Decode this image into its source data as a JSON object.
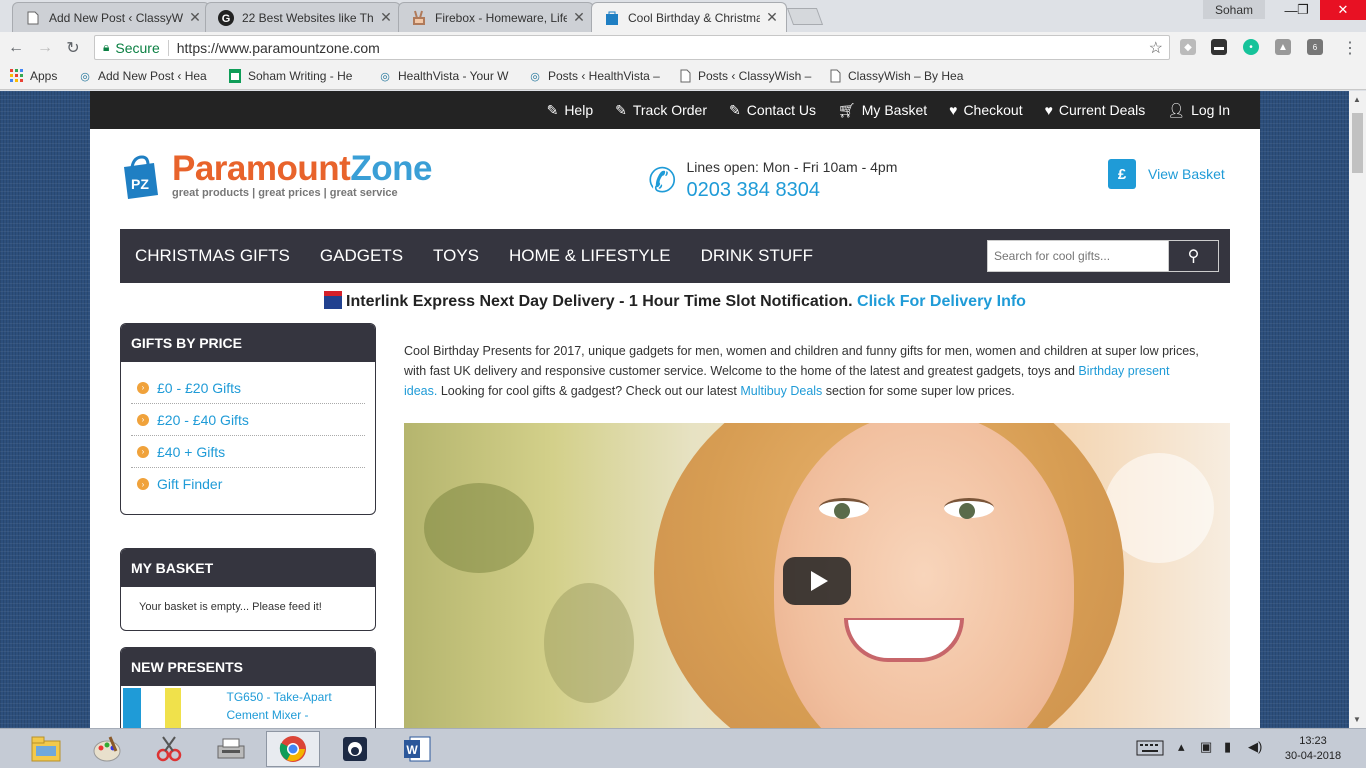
{
  "browser": {
    "tabs": [
      {
        "title": "Add New Post ‹ ClassyWi",
        "icon": "classywish-favicon"
      },
      {
        "title": "22 Best Websites like Thi",
        "icon": "g-favicon"
      },
      {
        "title": "Firebox - Homeware, Life",
        "icon": "firebox-favicon"
      },
      {
        "title": "Cool Birthday & Christma",
        "icon": "paramountzone-favicon",
        "active": true
      }
    ],
    "user": "Soham",
    "address": {
      "secure_label": "Secure",
      "url": "https://www.paramountzone.com"
    },
    "extension_badge": "6",
    "bookmarks": [
      {
        "label": "Apps",
        "icon": "apps-grid-icon"
      },
      {
        "label": "Add New Post ‹ Hea",
        "icon": "wordpress-icon"
      },
      {
        "label": "Soham Writing - He",
        "icon": "sheets-icon"
      },
      {
        "label": "HealthVista - Your W",
        "icon": "wordpress-icon"
      },
      {
        "label": "Posts ‹ HealthVista –",
        "icon": "wordpress-icon"
      },
      {
        "label": "Posts ‹ ClassyWish –",
        "icon": "page-icon"
      },
      {
        "label": "ClassyWish – By Hea",
        "icon": "page-icon"
      }
    ]
  },
  "site": {
    "topnav": [
      {
        "label": "Help",
        "icon": "edit-icon"
      },
      {
        "label": "Track Order",
        "icon": "edit-icon"
      },
      {
        "label": "Contact Us",
        "icon": "edit-icon"
      },
      {
        "label": "My Basket",
        "icon": "cart-icon"
      },
      {
        "label": "Checkout",
        "icon": "heart-icon"
      },
      {
        "label": "Current Deals",
        "icon": "heart-icon"
      },
      {
        "label": "Log In",
        "icon": "user-icon"
      }
    ],
    "logo": {
      "part1": "Paramount",
      "part2": "Zone",
      "tagline": "great products | great prices | great service"
    },
    "phone": {
      "hours": "Lines open: Mon - Fri 10am - 4pm",
      "number": "0203 384 8304"
    },
    "view_basket": "View Basket",
    "mainnav": [
      "CHRISTMAS GIFTS",
      "GADGETS",
      "TOYS",
      "HOME & LIFESTYLE",
      "DRINK STUFF"
    ],
    "search_placeholder": "Search for cool gifts...",
    "delivery": {
      "text": "Interlink Express Next Day Delivery - 1 Hour Time Slot Notification.",
      "link": "Click For Delivery Info"
    },
    "gifts_by_price": {
      "title": "GIFTS BY PRICE",
      "items": [
        "£0 - £20 Gifts",
        "£20 - £40 Gifts",
        "£40 + Gifts",
        "Gift Finder"
      ]
    },
    "my_basket": {
      "title": "MY BASKET",
      "empty": "Your basket is empty... Please feed it!"
    },
    "new_presents": {
      "title": "NEW PRESENTS",
      "items": [
        {
          "name": "TG650 - Take-Apart Cement Mixer -"
        }
      ]
    },
    "intro": {
      "part1": "Cool Birthday Presents for 2017, unique gadgets for men, women and children and funny gifts for men, women and children at super low prices, with fast UK delivery and responsive customer service. Welcome to the home of the latest and greatest gadgets, toys and ",
      "link1": "Birthday present ideas.",
      "part2": " Looking for cool gifts & gadgest? Check out our latest ",
      "link2": "Multibuy Deals",
      "part3": " section for some super low prices."
    }
  },
  "taskbar": {
    "apps": [
      "file-explorer-icon",
      "paint-icon",
      "snipping-tool-icon",
      "scanner-icon",
      "chrome-icon",
      "app-icon",
      "word-icon"
    ],
    "time": "13:23",
    "date": "30-04-2018"
  },
  "colors": {
    "accent": "#1f9bd7",
    "orange": "#e8632b",
    "nav_dark": "#35353f",
    "topbar": "#232323",
    "close_red": "#e81123"
  }
}
